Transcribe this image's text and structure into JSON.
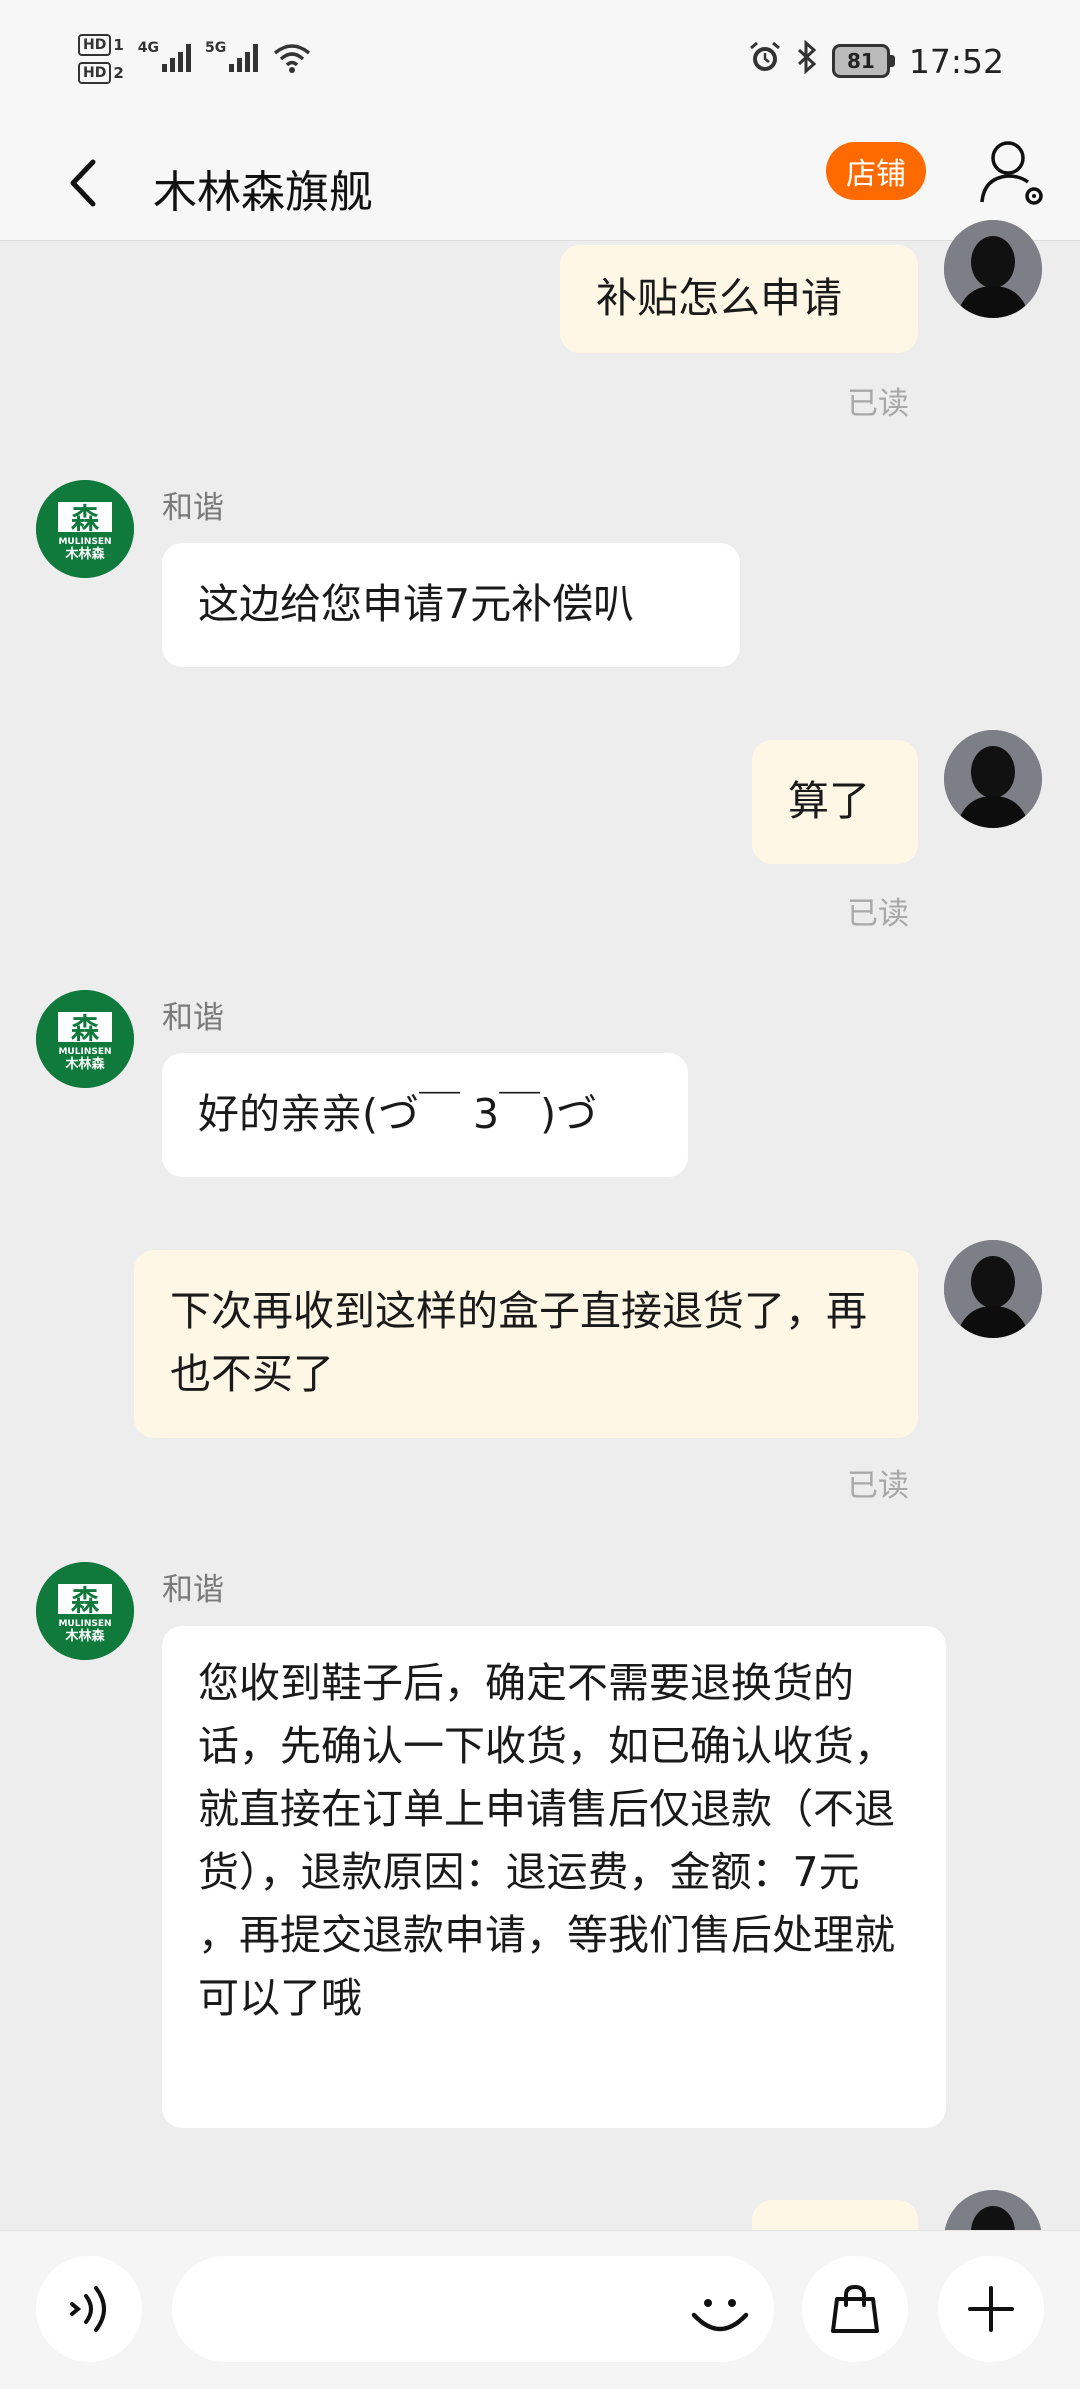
{
  "status_bar": {
    "hd1": "HD",
    "hd1_sub": "1",
    "hd2": "HD",
    "hd2_sub": "2",
    "net1": "4G",
    "net2": "5G",
    "battery": "81",
    "time": "17:52"
  },
  "header": {
    "title": "木林森旗舰",
    "shop_button": "店铺"
  },
  "shop_logo": {
    "mark": "森",
    "brand_en": "MULINSEN",
    "brand_cn": "木林森"
  },
  "messages": [
    {
      "id": 1,
      "from": "me",
      "text": "补贴怎么申请",
      "status": "已读"
    },
    {
      "id": 2,
      "from": "them",
      "sender": "和谐",
      "text": "这边给您申请7元补偿叭"
    },
    {
      "id": 3,
      "from": "me",
      "text": "算了",
      "status": "已读"
    },
    {
      "id": 4,
      "from": "them",
      "sender": "和谐",
      "text": "好的亲亲(づ￣ 3￣)づ"
    },
    {
      "id": 5,
      "from": "me",
      "text": "下次再收到这样的盒子直接退货了，再也不买了",
      "status": "已读"
    },
    {
      "id": 6,
      "from": "them",
      "sender": "和谐",
      "text": "您收到鞋子后，确定不需要退换货的话，先确认一下收货，如已确认收货，就直接在订单上申请售后仅退款（不退货），退款原因：退运费，金额：7元 ，再提交退款申请，等我们售后处理就可以了哦"
    }
  ],
  "input_bar": {
    "placeholder": ""
  },
  "colors": {
    "accent": "#ff6a00",
    "my_bubble": "#fff7e6",
    "their_bubble": "#ffffff",
    "background": "#ededed",
    "shop_green": "#0f7a3c"
  },
  "icons": [
    "back-arrow-icon",
    "user-settings-icon",
    "voice-icon",
    "emoji-icon",
    "bag-icon",
    "plus-icon",
    "alarm-icon",
    "bluetooth-icon",
    "wifi-icon"
  ]
}
